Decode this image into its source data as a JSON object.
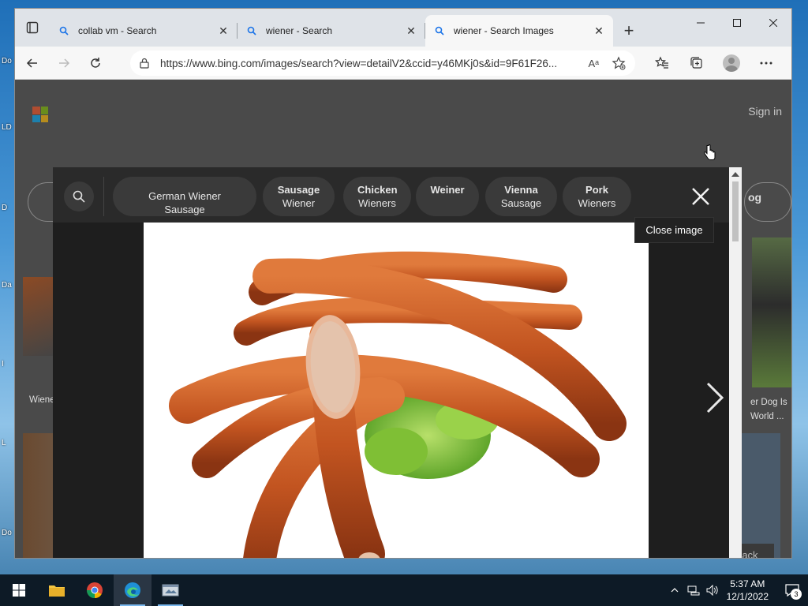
{
  "desktop": {
    "edge_labels": [
      "Do",
      "LD",
      "D",
      "Da",
      "I",
      "L",
      "Do"
    ]
  },
  "browser": {
    "tabs": [
      {
        "label": "collab vm - Search",
        "active": false
      },
      {
        "label": "wiener - Search",
        "active": false
      },
      {
        "label": "wiener - Search Images",
        "active": true
      }
    ],
    "address": {
      "url": "https://www.bing.com/images/search?view=detailV2&ccid=y46MKj0s&id=9F61F26...",
      "read_aloud_label": "Aᵃ"
    }
  },
  "page": {
    "sign_in": "Sign in",
    "caption_left": "Wiene",
    "caption_right": [
      "er Dog Is",
      " World ..."
    ],
    "pill_right_text": "og",
    "feedback": "Feedback"
  },
  "viewer": {
    "chips": [
      {
        "top": "German Wiener Sausage",
        "bottom": ""
      },
      {
        "top": "Sausage",
        "bottom": "Wiener"
      },
      {
        "top": "Chicken",
        "bottom": "Wieners"
      },
      {
        "top": "Weiner",
        "bottom": ""
      },
      {
        "top": "Vienna",
        "bottom": "Sausage"
      },
      {
        "top": "Pork",
        "bottom": "Wieners"
      }
    ],
    "close_tooltip": "Close image"
  },
  "taskbar": {
    "time": "5:37 AM",
    "date": "12/1/2022",
    "notification_count": "3"
  },
  "colors": {
    "accent": "#0078d4",
    "modal_bg": "#1e1e1e",
    "chip_bg": "#3a3a3a",
    "sausage": "#c65a24"
  }
}
